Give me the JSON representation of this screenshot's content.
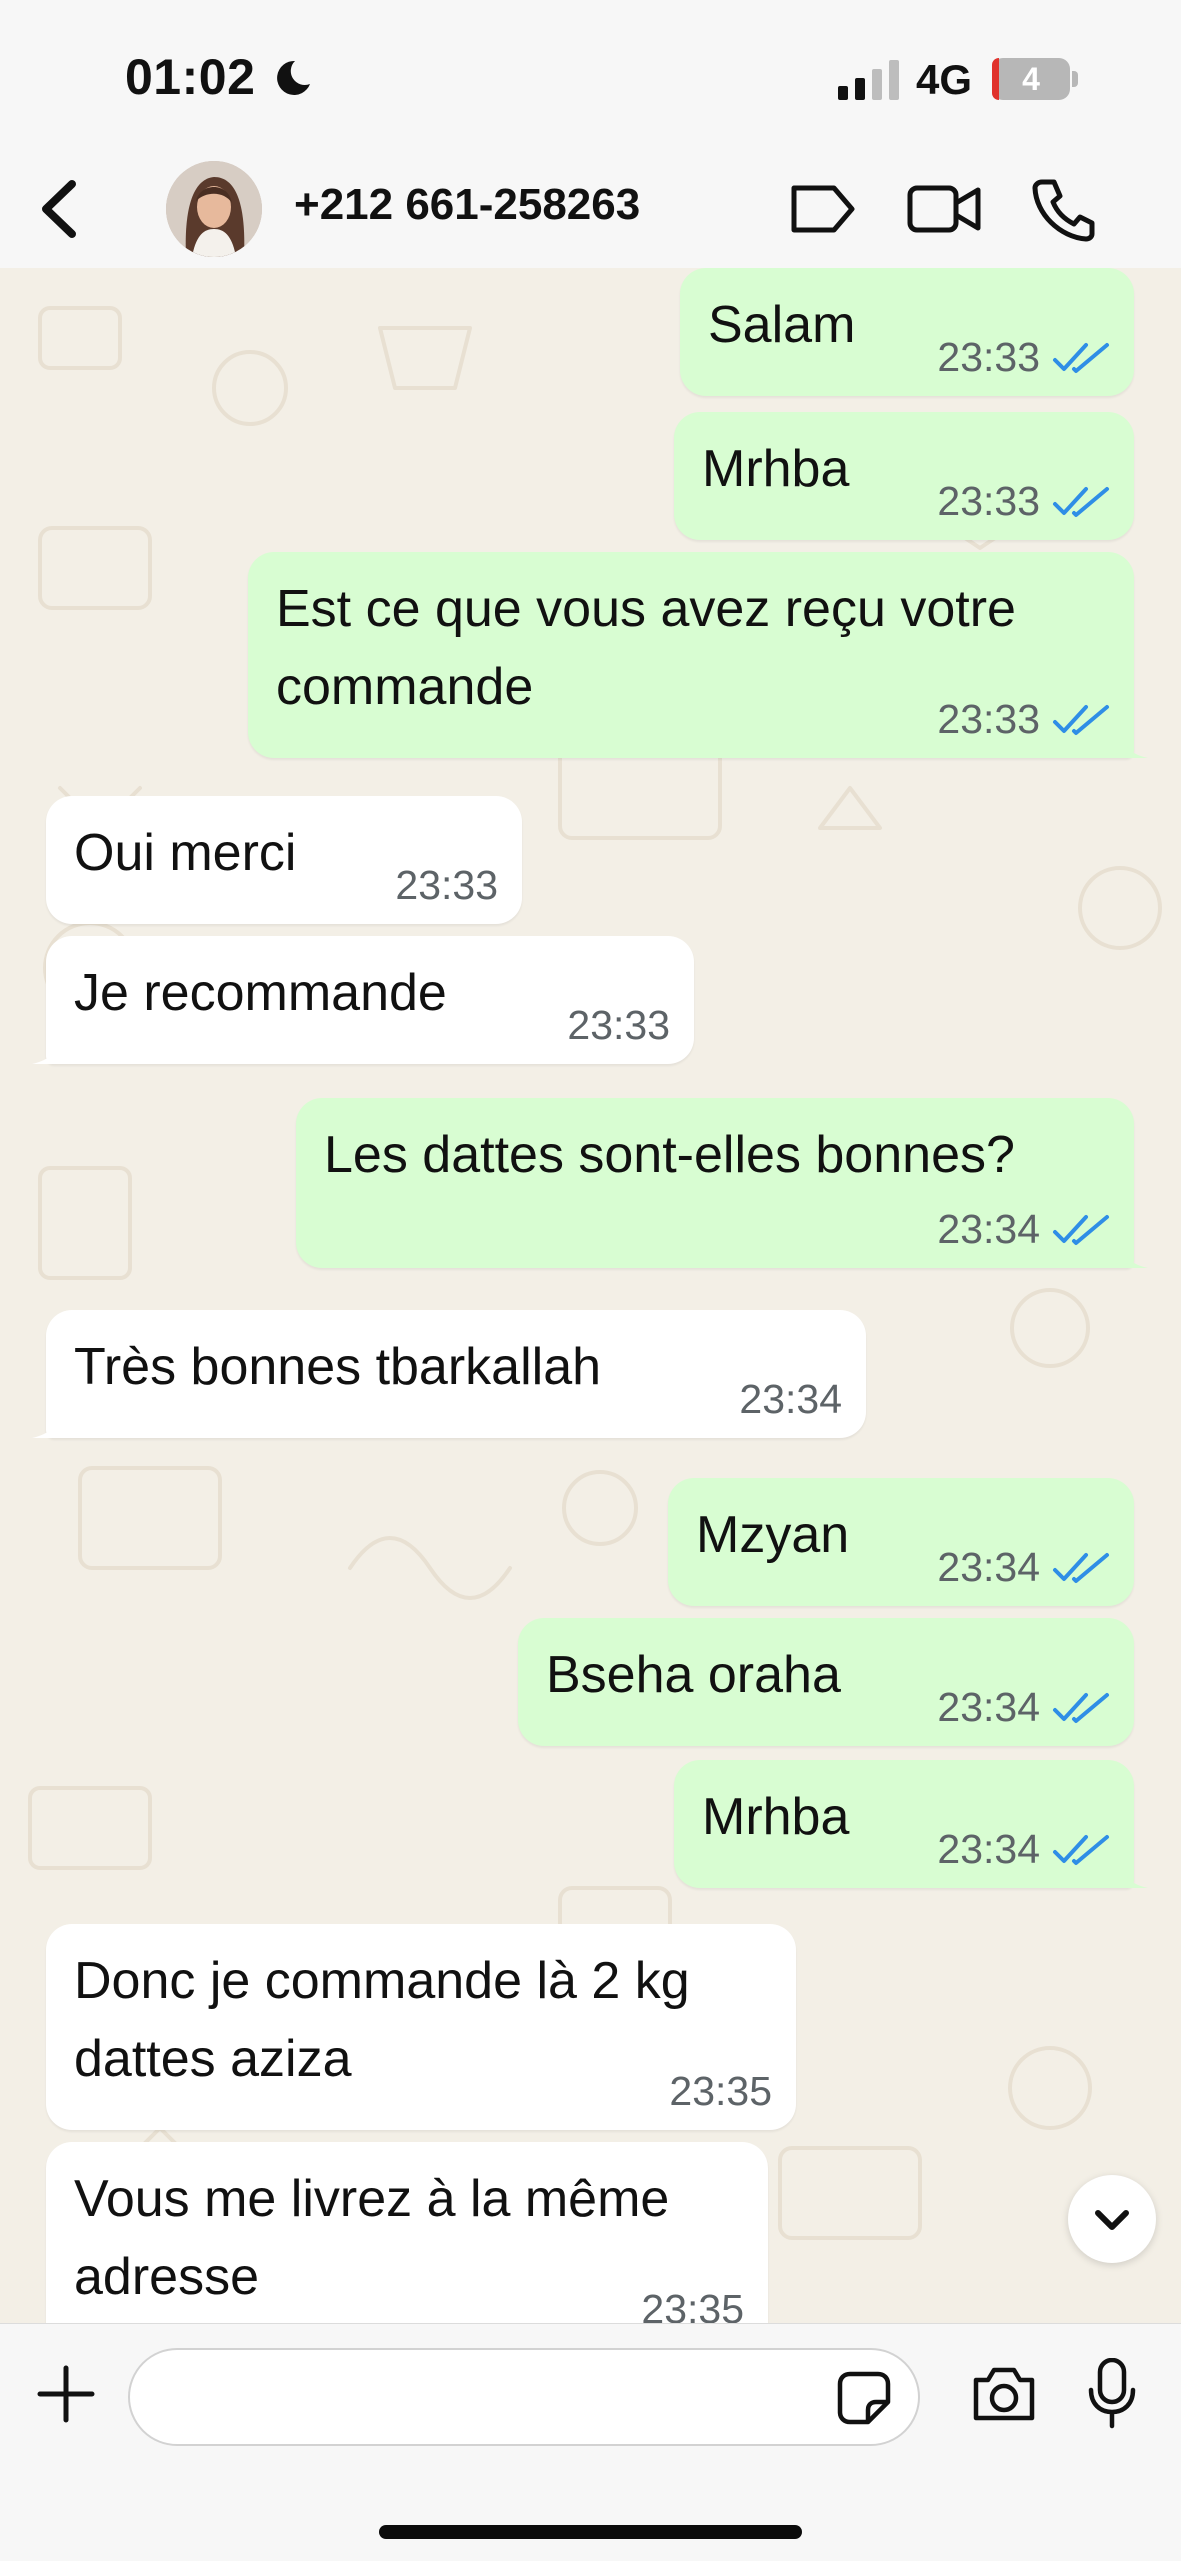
{
  "status_bar": {
    "time": "01:02",
    "network": "4G",
    "battery_level": "4"
  },
  "header": {
    "contact": "+212 661-258263"
  },
  "messages": [
    {
      "dir": "out",
      "lines": [
        "Salam"
      ],
      "time": "23:33",
      "read": true
    },
    {
      "dir": "out",
      "lines": [
        "Mrhba"
      ],
      "time": "23:33",
      "read": true
    },
    {
      "dir": "out",
      "lines": [
        "Est ce que vous avez reçu votre",
        "commande"
      ],
      "time": "23:33",
      "read": true
    },
    {
      "dir": "in",
      "lines": [
        "Oui merci"
      ],
      "time": "23:33"
    },
    {
      "dir": "in",
      "lines": [
        "Je recommande"
      ],
      "time": "23:33"
    },
    {
      "dir": "out",
      "lines": [
        "Les dattes sont-elles bonnes?"
      ],
      "time": "23:34",
      "read": true
    },
    {
      "dir": "in",
      "lines": [
        "Très bonnes tbarkallah"
      ],
      "time": "23:34"
    },
    {
      "dir": "out",
      "lines": [
        "Mzyan"
      ],
      "time": "23:34",
      "read": true
    },
    {
      "dir": "out",
      "lines": [
        "Bseha oraha"
      ],
      "time": "23:34",
      "read": true
    },
    {
      "dir": "out",
      "lines": [
        "Mrhba"
      ],
      "time": "23:34",
      "read": true
    },
    {
      "dir": "in",
      "lines": [
        "Donc je commande là 2 kg",
        "dattes aziza"
      ],
      "time": "23:35"
    },
    {
      "dir": "in",
      "lines": [
        "Vous me livrez à la même",
        "adresse"
      ],
      "time": "23:35"
    }
  ],
  "composer": {
    "value": ""
  },
  "colors": {
    "outgoing": "#d8fdd2",
    "incoming": "#ffffff",
    "tick_read": "#2f8ee6",
    "wallpaper": "#f3efe6"
  }
}
